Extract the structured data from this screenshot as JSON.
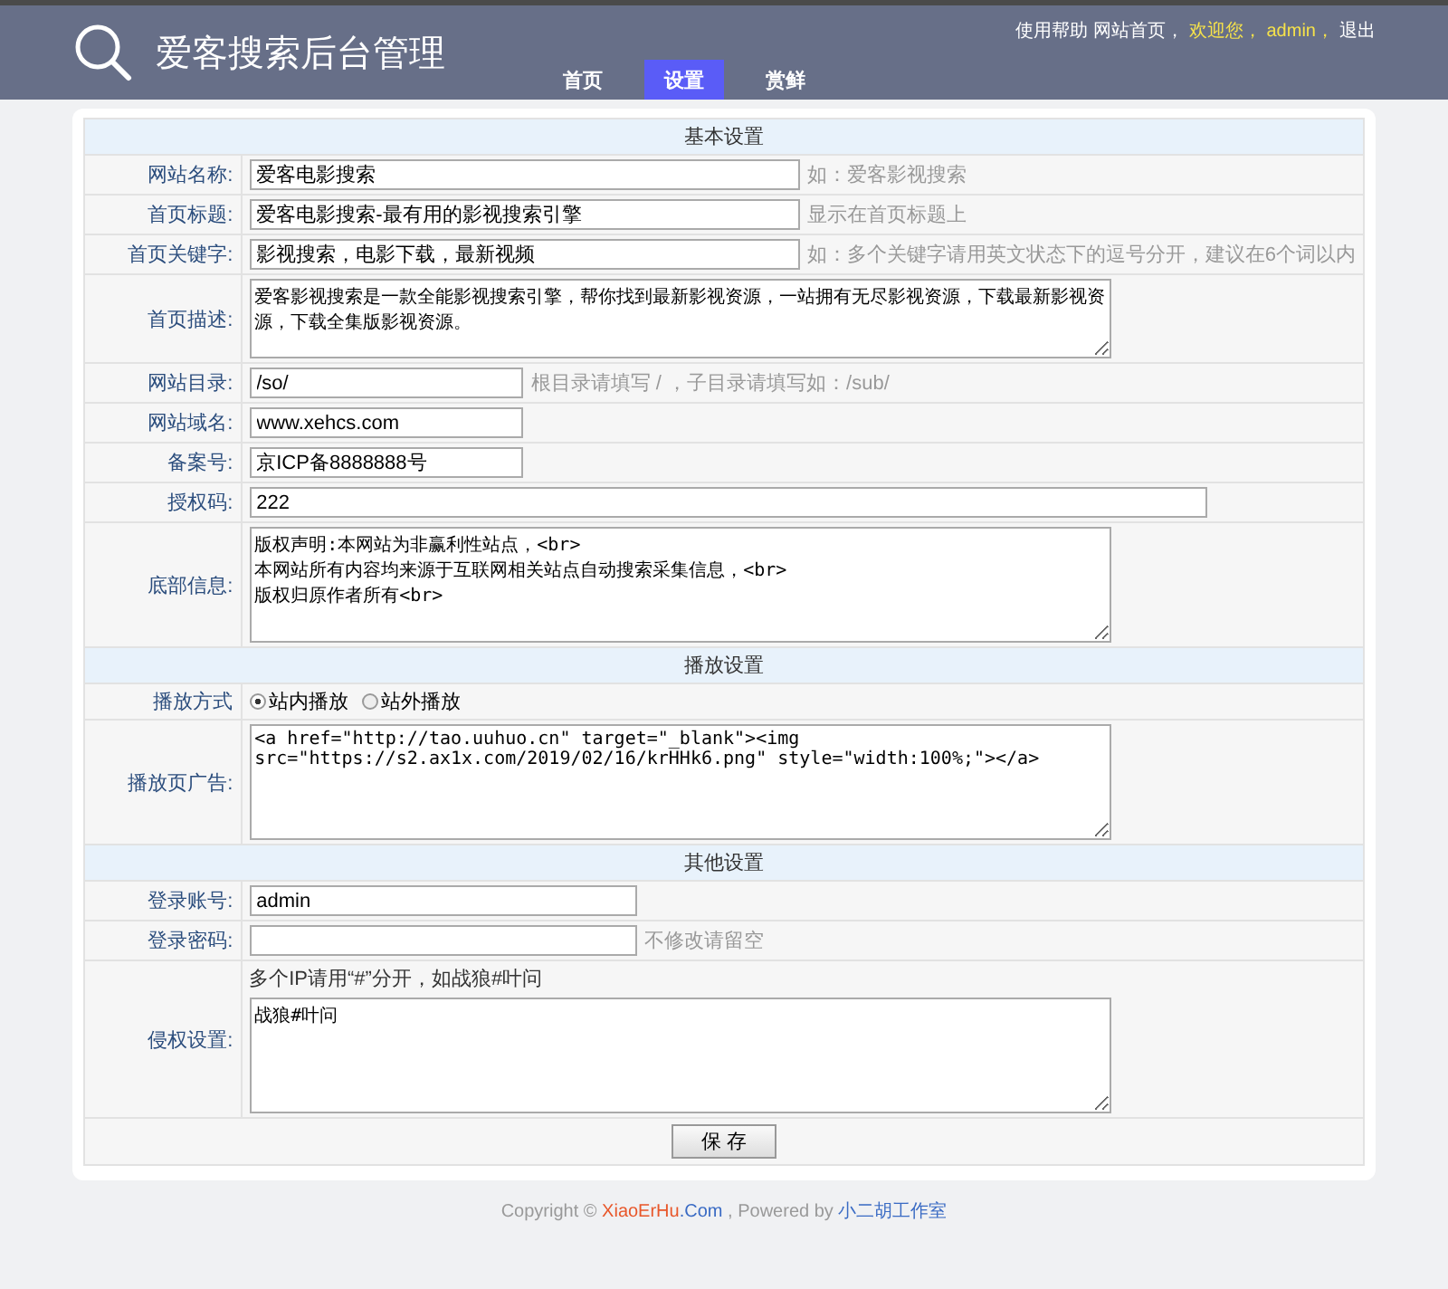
{
  "header": {
    "title": "爱客搜索后台管理",
    "nav": [
      {
        "label": "首页",
        "selected": false
      },
      {
        "label": "设置",
        "selected": true
      },
      {
        "label": "赏鲜",
        "selected": false
      }
    ],
    "top_links": [
      {
        "label": "使用帮助",
        "highlight": false
      },
      {
        "label": "网站首页，",
        "highlight": false
      },
      {
        "label": "欢迎您，",
        "highlight": true
      },
      {
        "label": "admin，",
        "highlight": true
      },
      {
        "label": "退出",
        "highlight": false
      }
    ]
  },
  "rows": [
    {
      "kind": "section",
      "title": "基本设置"
    },
    {
      "kind": "text",
      "label": "网站名称:",
      "value": "爱客电影搜索",
      "hint": "如：爱客影视搜索"
    },
    {
      "kind": "text",
      "label": "首页标题:",
      "value": "爱客电影搜索-最有用的影视搜索引擎",
      "hint": "显示在首页标题上"
    },
    {
      "kind": "text",
      "label": "首页关键字:",
      "value": "影视搜索，电影下载，最新视频",
      "hint": "如：多个关键字请用英文状态下的逗号分开，建议在6个词以内"
    },
    {
      "kind": "textarea",
      "label": "首页描述:",
      "value": "爱客影视搜索是一款全能影视搜索引擎，帮你找到最新影视资源，一站拥有无尽影视资源，下载最新影视资源，下载全集版影视资源。"
    },
    {
      "kind": "short",
      "label": "网站目录:",
      "value": "/so/",
      "hint": "根目录请填写 / ，子目录请填写如：/sub/"
    },
    {
      "kind": "short",
      "label": "网站域名:",
      "value": "www.xehcs.com"
    },
    {
      "kind": "short",
      "label": "备案号:",
      "value": "京ICP备8888888号"
    },
    {
      "kind": "wide",
      "label": "授权码:",
      "value": "222"
    },
    {
      "kind": "memo",
      "label": "底部信息:",
      "value": "版权声明:本网站为非赢利性站点，<br>\n本网站所有内容均来源于互联网相关站点自动搜索采集信息，<br>\n版权归原作者所有<br>"
    },
    {
      "kind": "section",
      "title": "播放设置"
    },
    {
      "kind": "radio",
      "label": "播放方式",
      "options": [
        {
          "label": "站内播放",
          "selected": true
        },
        {
          "label": "站外播放",
          "selected": false
        }
      ]
    },
    {
      "kind": "memo",
      "label": "播放页广告:",
      "value": "<a href=\"http://tao.uuhuo.cn\" target=\"_blank\"><img src=\"https://s2.ax1x.com/2019/02/16/krHHk6.png\" style=\"width:100%;\"></a>"
    },
    {
      "kind": "section",
      "title": "其他设置"
    },
    {
      "kind": "account",
      "label": "登录账号:",
      "value": "admin"
    },
    {
      "kind": "password",
      "label": "登录密码:",
      "hint": "不修改请留空"
    },
    {
      "kind": "memo",
      "label": "侵权设置:",
      "note": "多个IP请用“#”分开，如战狼#叶问",
      "value": "战狼#叶问"
    }
  ],
  "save_button": "保 存",
  "footer": {
    "prefix": "Copyright © ",
    "site_name": "XiaoErHu",
    "site_suffix": ".Com",
    "middle": " , Powered by ",
    "studio": "小二胡工作室"
  }
}
